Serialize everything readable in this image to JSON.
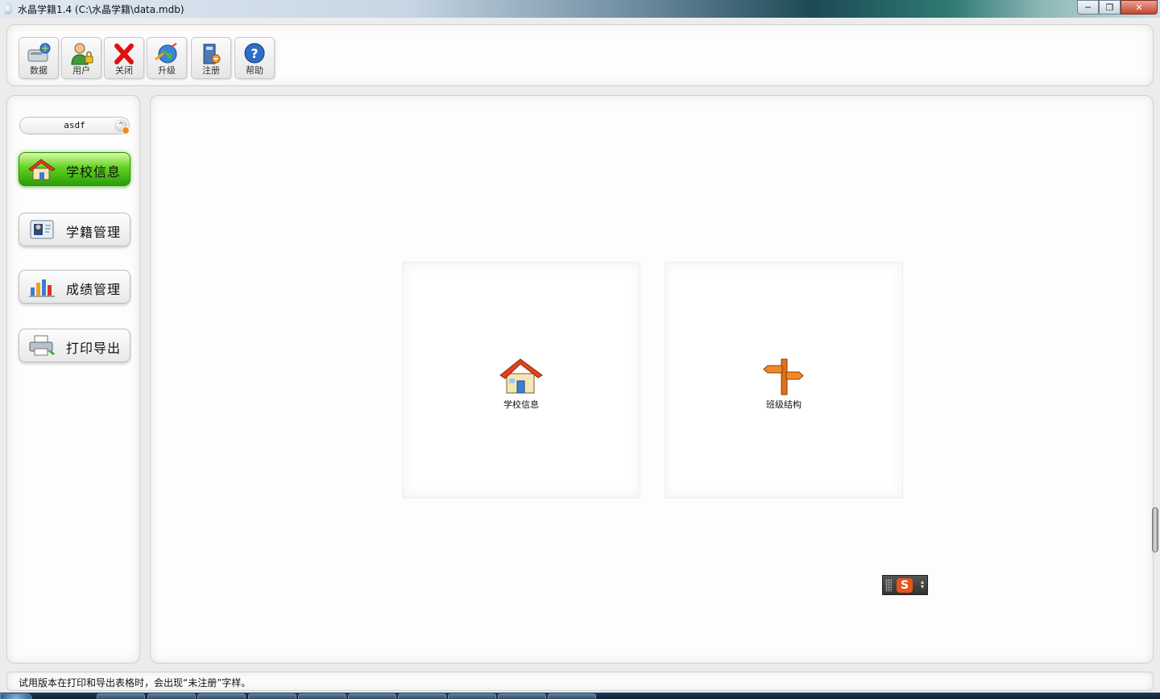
{
  "window": {
    "title": "水晶学籍1.4  (C:\\水晶学籍\\data.mdb)",
    "controls": [
      "minimize",
      "maximize",
      "close"
    ]
  },
  "toolbar": {
    "buttons": [
      {
        "label": "数据",
        "icon": "database-icon"
      },
      {
        "label": "用户",
        "icon": "user-lock-icon"
      },
      {
        "label": "关闭",
        "icon": "close-x-icon"
      },
      {
        "label": "升级",
        "icon": "upgrade-globe-icon"
      },
      {
        "label": "注册",
        "icon": "register-icon"
      },
      {
        "label": "帮助",
        "icon": "help-icon"
      }
    ]
  },
  "sidebar": {
    "user_select": {
      "value": "asdf"
    },
    "items": [
      {
        "label": "学校信息",
        "icon": "school-house-icon",
        "active": true
      },
      {
        "label": "学籍管理",
        "icon": "student-card-icon",
        "active": false
      },
      {
        "label": "成绩管理",
        "icon": "grades-chart-icon",
        "active": false
      },
      {
        "label": "打印导出",
        "icon": "printer-icon",
        "active": false
      }
    ]
  },
  "main": {
    "cards": [
      {
        "label": "学校信息",
        "icon": "school-house-icon"
      },
      {
        "label": "班级结构",
        "icon": "signpost-icon"
      }
    ]
  },
  "ime": {
    "logo": "S"
  },
  "status": {
    "text": "试用版本在打印和导出表格时，会出现“未注册”字样。"
  },
  "colors": {
    "active_nav": "#4fc71a",
    "close_button": "#c7452d",
    "accent_orange": "#f08a24"
  }
}
